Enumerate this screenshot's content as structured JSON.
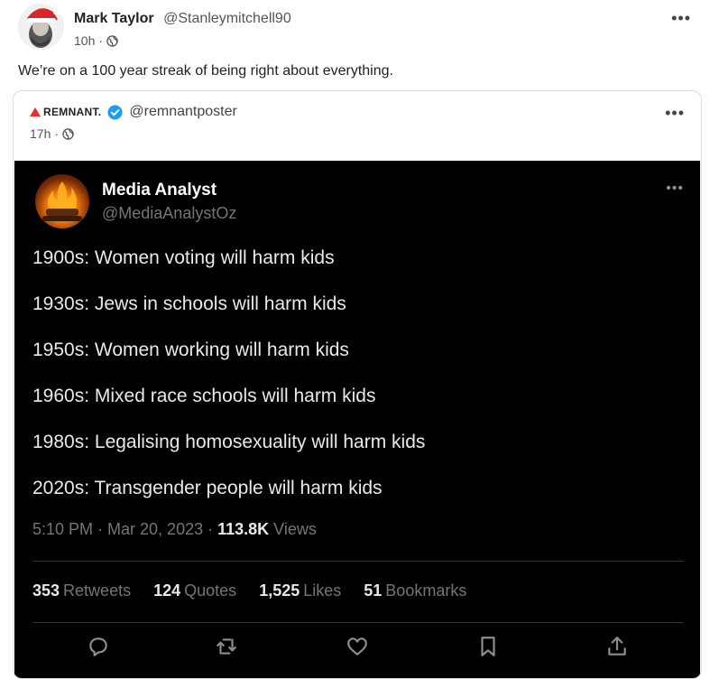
{
  "post": {
    "author_name": "Mark Taylor",
    "author_handle": "@Stanleymitchell90",
    "time": "10h",
    "separator": "·",
    "text": "We’re on a 100 year streak of being right about everything.",
    "more_label": "•••"
  },
  "quote": {
    "brand": "REMNANT.",
    "handle": "@remnantposter",
    "time": "17h",
    "separator": "·",
    "more_label": "•••",
    "embedded_tweet": {
      "name": "Media Analyst",
      "handle": "@MediaAnalystOz",
      "more_label": "•••",
      "lines": [
        "1900s: Women voting will harm kids",
        "1930s: Jews in schools will harm kids",
        "1950s: Women working will harm kids",
        "1960s: Mixed race schools will harm kids",
        "1980s: Legalising homosexuality will harm kids",
        "2020s: Transgender people will harm kids"
      ],
      "timestamp": "5:10 PM · Mar 20, 2023 · ",
      "views_count": "113.8K",
      "views_label": "Views",
      "stats": [
        {
          "num": "353",
          "label": "Retweets"
        },
        {
          "num": "124",
          "label": "Quotes"
        },
        {
          "num": "1,525",
          "label": "Likes"
        },
        {
          "num": "51",
          "label": "Bookmarks"
        }
      ],
      "actions": [
        "reply-icon",
        "retweet-icon",
        "like-icon",
        "bookmark-icon",
        "share-icon"
      ]
    }
  },
  "colors": {
    "brand_red": "#e0312f",
    "verified_blue": "#1d9bf0",
    "dark_bg": "#000000"
  }
}
